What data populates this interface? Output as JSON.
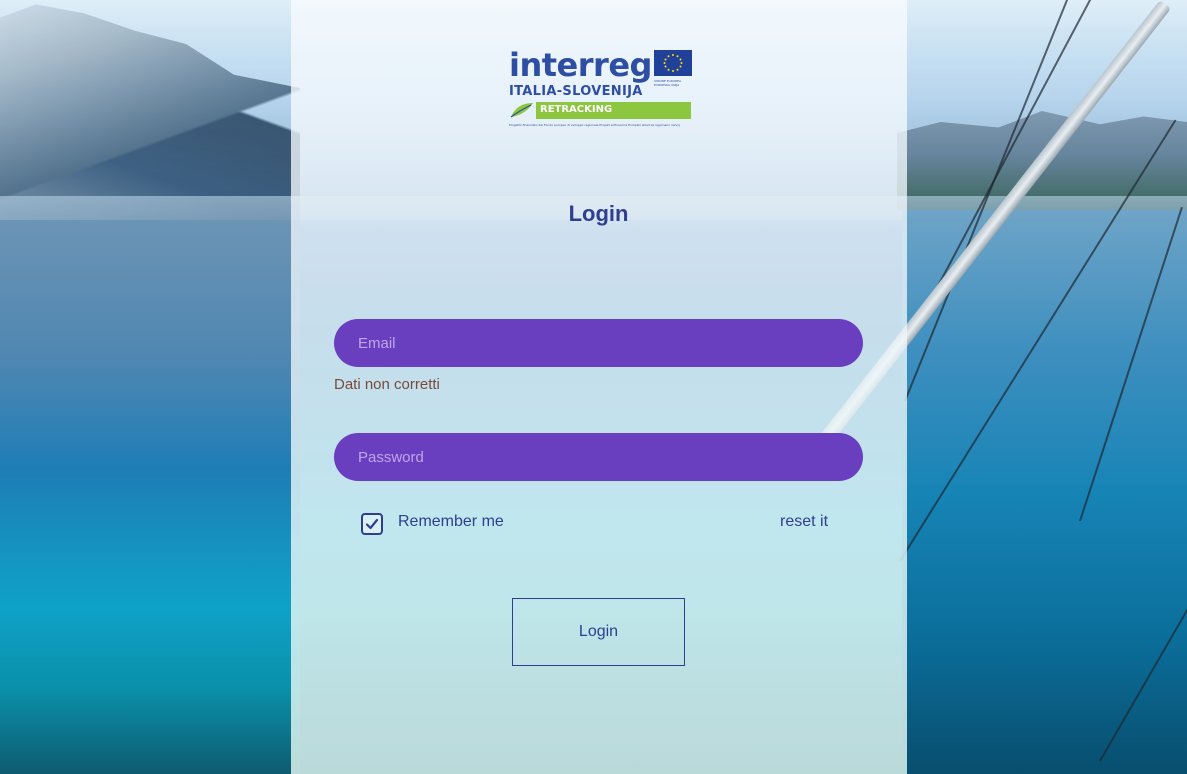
{
  "logo": {
    "wordmark": "interreg",
    "subtitle": "ITALIA-SLOVENIJA",
    "project_bar": "RETRACKING",
    "eu_caption": "UNIONE EUROPEA EVROPSKA UNIJA",
    "fine_print": "Progetto finanziato dal Fondo europeo di sviluppo regionale Projekt sofinancira Evropski sklad za regionalni razvoj",
    "brand_color": "#2e4ea3",
    "bar_color": "#8dc63f"
  },
  "form": {
    "title": "Login",
    "email_placeholder": "Email",
    "error_message": "Dati non corretti",
    "password_placeholder": "Password",
    "remember_label": "Remember me",
    "remember_checked": true,
    "reset_link": "reset it",
    "submit_label": "Login",
    "field_color": "#6a3fbf",
    "text_color": "#2e3f8f"
  }
}
